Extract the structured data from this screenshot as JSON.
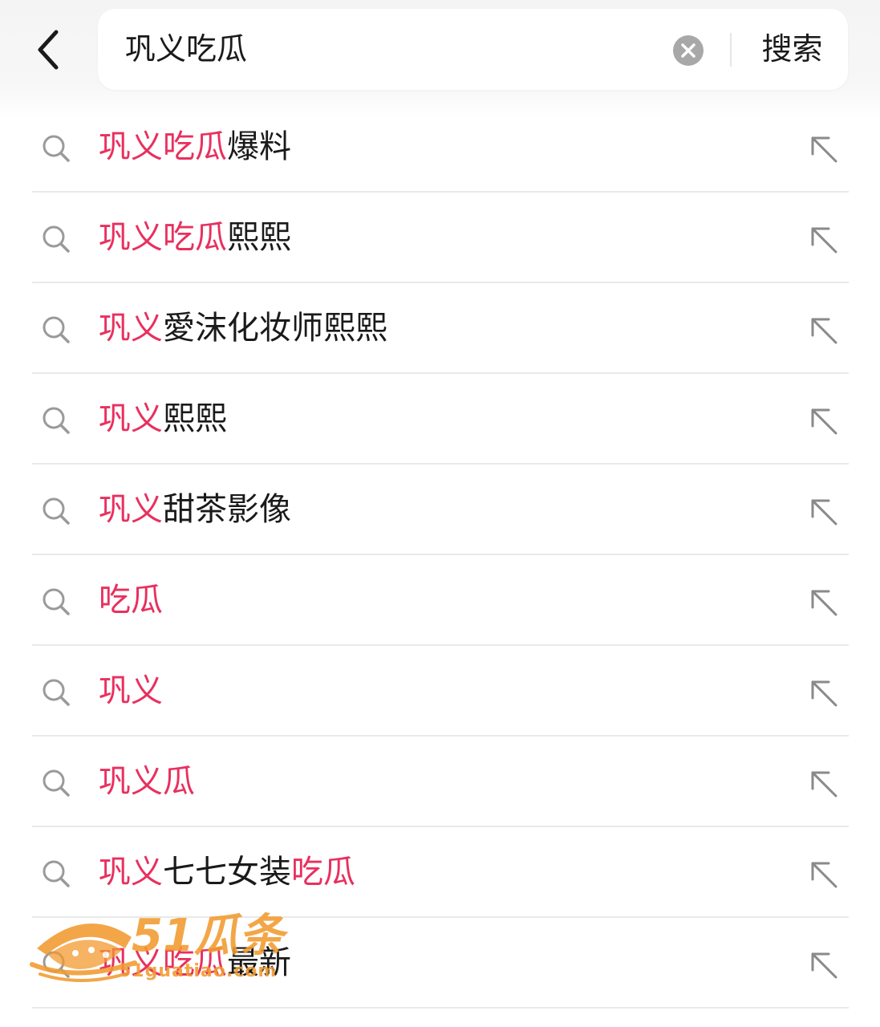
{
  "search": {
    "query": "巩义吃瓜",
    "submit_label": "搜索"
  },
  "suggestions": [
    {
      "parts": [
        {
          "t": "巩义吃瓜",
          "hl": true
        },
        {
          "t": "爆料",
          "hl": false
        }
      ]
    },
    {
      "parts": [
        {
          "t": "巩义吃瓜",
          "hl": true
        },
        {
          "t": "熙熙",
          "hl": false
        }
      ]
    },
    {
      "parts": [
        {
          "t": "巩义",
          "hl": true
        },
        {
          "t": "愛沫化妆师熙熙",
          "hl": false
        }
      ]
    },
    {
      "parts": [
        {
          "t": "巩义",
          "hl": true
        },
        {
          "t": "熙熙",
          "hl": false
        }
      ]
    },
    {
      "parts": [
        {
          "t": "巩义",
          "hl": true
        },
        {
          "t": "甜茶影像",
          "hl": false
        }
      ]
    },
    {
      "parts": [
        {
          "t": "吃瓜",
          "hl": true
        }
      ]
    },
    {
      "parts": [
        {
          "t": "巩义",
          "hl": true
        }
      ]
    },
    {
      "parts": [
        {
          "t": "巩义瓜",
          "hl": true
        }
      ]
    },
    {
      "parts": [
        {
          "t": "巩义",
          "hl": true
        },
        {
          "t": "七七女装",
          "hl": false
        },
        {
          "t": "吃瓜",
          "hl": true
        }
      ]
    },
    {
      "parts": [
        {
          "t": "巩义吃瓜",
          "hl": true
        },
        {
          "t": "最新",
          "hl": false
        }
      ]
    }
  ],
  "watermark": {
    "title": "51瓜条",
    "subtitle": "51guatiao.com"
  },
  "colors": {
    "highlight": "#e8305e",
    "text": "#1a1a1a",
    "icon": "#9a9a9a",
    "watermark": "#f29a2e"
  },
  "icons": {
    "back": "chevron-left-icon",
    "clear": "clear-circle-icon",
    "suggestion": "search-icon",
    "fill": "arrow-up-left-icon"
  }
}
